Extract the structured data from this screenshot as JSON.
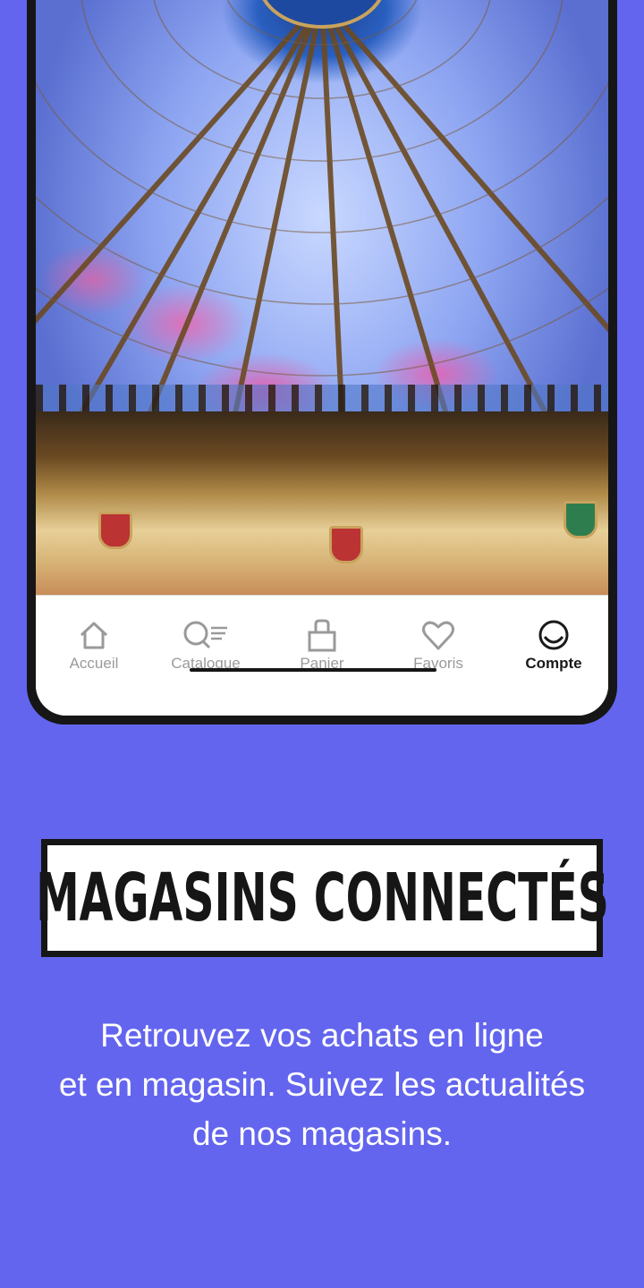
{
  "image": {
    "description_icon": "dome-photo"
  },
  "tabbar": {
    "items": [
      {
        "label": "Accueil",
        "icon": "home-icon",
        "active": false
      },
      {
        "label": "Catalogue",
        "icon": "catalogue-search-icon",
        "active": false
      },
      {
        "label": "Panier",
        "icon": "bag-icon",
        "active": false
      },
      {
        "label": "Favoris",
        "icon": "heart-icon",
        "active": false
      },
      {
        "label": "Compte",
        "icon": "account-icon",
        "active": true
      }
    ]
  },
  "promo": {
    "headline": "MAGASINS CONNECTÉS",
    "lines": [
      "Retrouvez vos achats en ligne",
      "et en magasin. Suivez les actualités",
      "de nos magasins."
    ]
  },
  "colors": {
    "background": "#6365EE",
    "frame": "#161616",
    "active_tab": "#1a1a1a",
    "inactive_tab": "#9a9a9a"
  }
}
